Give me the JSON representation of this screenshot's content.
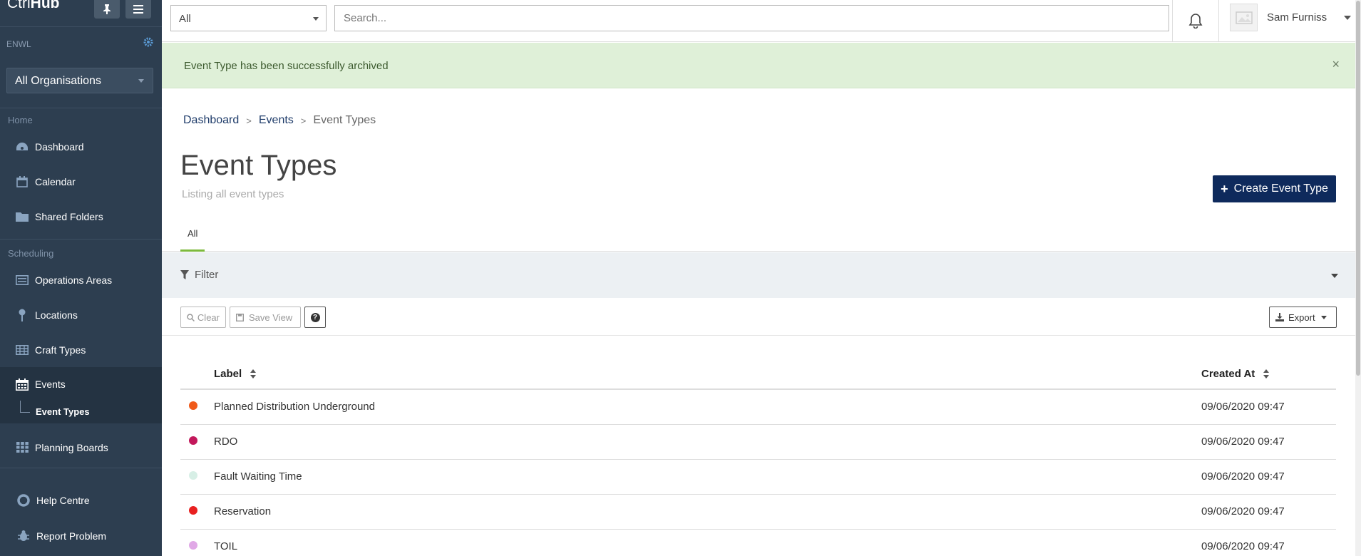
{
  "app": {
    "logo_light": "Ctrl",
    "logo_bold": "Hub"
  },
  "sidebar": {
    "org_code": "ENWL",
    "org_select": "All Organisations",
    "sections": {
      "home": "Home",
      "scheduling": "Scheduling"
    },
    "items": [
      {
        "label": "Dashboard",
        "icon": "dashboard-icon"
      },
      {
        "label": "Calendar",
        "icon": "calendar-icon"
      },
      {
        "label": "Shared Folders",
        "icon": "folder-icon"
      },
      {
        "label": "Operations Areas",
        "icon": "list-icon"
      },
      {
        "label": "Locations",
        "icon": "pin-icon"
      },
      {
        "label": "Craft Types",
        "icon": "table-icon"
      },
      {
        "label": "Events",
        "icon": "calendar-grid-icon"
      },
      {
        "label": "Event Types",
        "icon": ""
      },
      {
        "label": "Planning Boards",
        "icon": "grid-icon"
      },
      {
        "label": "Help Centre",
        "icon": "lifebuoy-icon"
      },
      {
        "label": "Report Problem",
        "icon": "bug-icon"
      }
    ]
  },
  "topbar": {
    "scope": "All",
    "search_placeholder": "Search...",
    "user_name": "Sam Furniss"
  },
  "alert": {
    "message": "Event Type has been successfully archived",
    "close": "×"
  },
  "breadcrumb": {
    "items": [
      "Dashboard",
      "Events"
    ],
    "current": "Event Types"
  },
  "page": {
    "title": "Event Types",
    "subtitle": "Listing all event types",
    "create_button": "Create Event Type"
  },
  "tabs": [
    {
      "label": "All",
      "active": true
    }
  ],
  "filter": {
    "label": "Filter"
  },
  "toolbar": {
    "clear": "Clear",
    "save_view": "Save View",
    "help": "?",
    "export": "Export"
  },
  "table": {
    "columns": [
      "Label",
      "Created At"
    ],
    "rows": [
      {
        "label": "Planned Distribution Underground",
        "created_at": "09/06/2020 09:47",
        "color": "#f05a1a"
      },
      {
        "label": "RDO",
        "created_at": "09/06/2020 09:47",
        "color": "#c2185b"
      },
      {
        "label": "Fault Waiting Time",
        "created_at": "09/06/2020 09:47",
        "color": "#d7efe6"
      },
      {
        "label": "Reservation",
        "created_at": "09/06/2020 09:47",
        "color": "#e82020"
      },
      {
        "label": "TOIL",
        "created_at": "09/06/2020 09:47",
        "color": "#e0a8e6"
      }
    ]
  },
  "colors": {
    "sidebar": "#2d3e50",
    "primary_button": "#0e2a5c",
    "alert_bg": "#dff0d8",
    "tab_accent": "#7dba3d"
  }
}
